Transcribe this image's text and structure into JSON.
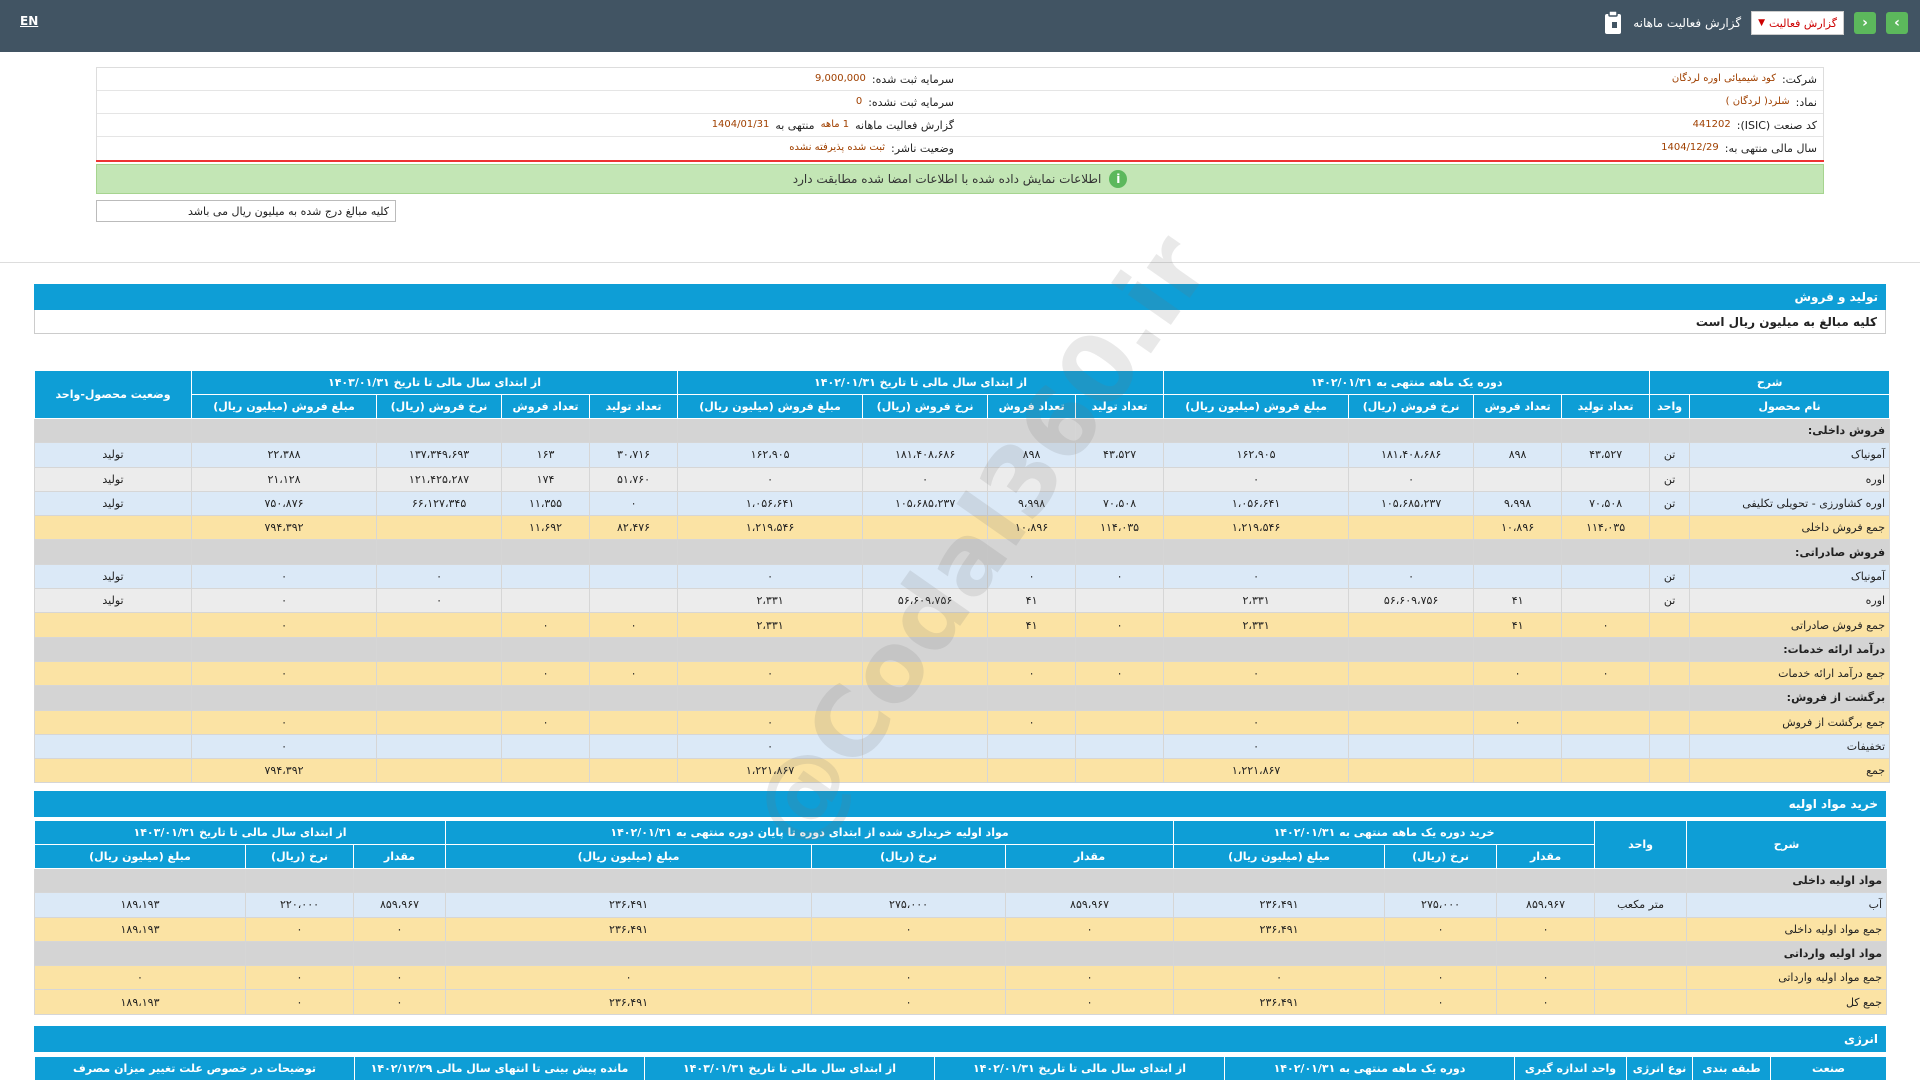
{
  "topbar": {
    "lang": "EN",
    "title": "گزارش فعالیت ماهانه",
    "select_value": "گزارش فعالیت",
    "prev_label": "›",
    "next_label": "‹"
  },
  "info": {
    "company_label": "شرکت:",
    "company_value": "کود شیمیائی اوره لردگان",
    "symbol_label": "نماد:",
    "symbol_value": "شلرد( لردگان )",
    "isic_label": "کد صنعت (ISIC):",
    "isic_value": "441202",
    "fy_label": "سال مالی منتهی به:",
    "fy_value": "1404/12/29",
    "capital_label": "سرمایه ثبت شده:",
    "capital_value": "9,000,000",
    "unreg_label": "سرمایه ثبت نشده:",
    "unreg_value": "0",
    "report_label": "گزارش فعالیت ماهانه",
    "report_value": "1 ماهه",
    "report_suffix": "منتهی به",
    "report_date": "1404/01/31",
    "status_label": "وضعیت ناشر:",
    "status_value": "ثبت شده پذیرفته نشده"
  },
  "green_message": "اطلاعات نمایش داده شده با اطلاعات امضا شده مطابقت دارد",
  "note": "کلیه مبالغ درج شده به میلیون ریال می باشد",
  "watermark": "@Codal360.ir",
  "production": {
    "title": "تولید و فروش",
    "subtitle": "کلیه مبالغ به میلیون ریال است",
    "h1": [
      "شرح",
      "دوره یک ماهه منتهی به ۱۴۰۲/۰۱/۳۱",
      "از ابتدای سال مالی تا تاریخ ۱۴۰۲/۰۱/۳۱",
      "از ابتدای سال مالی تا تاریخ ۱۴۰۳/۰۱/۳۱",
      "وضعیت محصول-واحد"
    ],
    "h2": [
      "نام محصول",
      "واحد",
      "تعداد تولید",
      "تعداد فروش",
      "نرخ فروش (ریال)",
      "مبلغ فروش (میلیون ریال)",
      "تعداد تولید",
      "تعداد فروش",
      "نرخ فروش (ریال)",
      "مبلغ فروش (میلیون ریال)",
      "تعداد تولید",
      "تعداد فروش",
      "نرخ فروش (ریال)",
      "مبلغ فروش (میلیون ریال)"
    ],
    "rows": [
      {
        "t": "grp",
        "c": [
          "فروش داخلی:",
          "",
          "",
          "",
          "",
          "",
          "",
          "",
          "",
          "",
          "",
          "",
          "",
          "",
          ""
        ]
      },
      {
        "t": "blue",
        "c": [
          "آمونیاک",
          "تن",
          "۴۳،۵۲۷",
          "۸۹۸",
          "۱۸۱،۴۰۸،۶۸۶",
          "۱۶۲،۹۰۵",
          "۴۳،۵۲۷",
          "۸۹۸",
          "۱۸۱،۴۰۸،۶۸۶",
          "۱۶۲،۹۰۵",
          "۳۰،۷۱۶",
          "۱۶۳",
          "۱۳۷،۳۴۹،۶۹۳",
          "۲۲،۳۸۸",
          "تولید"
        ]
      },
      {
        "t": "gray",
        "c": [
          "اوره",
          "تن",
          "",
          "",
          "۰",
          "۰",
          "",
          "",
          "۰",
          "۰",
          "۵۱،۷۶۰",
          "۱۷۴",
          "۱۲۱،۴۲۵،۲۸۷",
          "۲۱،۱۲۸",
          "تولید"
        ]
      },
      {
        "t": "blue",
        "c": [
          "اوره کشاورزی - تحویلی تکلیفی",
          "تن",
          "۷۰،۵۰۸",
          "۹،۹۹۸",
          "۱۰۵،۶۸۵،۲۳۷",
          "۱،۰۵۶،۶۴۱",
          "۷۰،۵۰۸",
          "۹،۹۹۸",
          "۱۰۵،۶۸۵،۲۳۷",
          "۱،۰۵۶،۶۴۱",
          "۰",
          "۱۱،۳۵۵",
          "۶۶،۱۲۷،۳۴۵",
          "۷۵۰،۸۷۶",
          "تولید"
        ]
      },
      {
        "t": "yel",
        "c": [
          "جمع فروش داخلی",
          "",
          "۱۱۴،۰۳۵",
          "۱۰،۸۹۶",
          "",
          "۱،۲۱۹،۵۴۶",
          "۱۱۴،۰۳۵",
          "۱۰،۸۹۶",
          "",
          "۱،۲۱۹،۵۴۶",
          "۸۲،۴۷۶",
          "۱۱،۶۹۲",
          "",
          "۷۹۴،۳۹۲",
          ""
        ]
      },
      {
        "t": "grp",
        "c": [
          "فروش صادراتی:",
          "",
          "",
          "",
          "",
          "",
          "",
          "",
          "",
          "",
          "",
          "",
          "",
          "",
          ""
        ]
      },
      {
        "t": "blue",
        "c": [
          "آمونیاک",
          "تن",
          "",
          "",
          "۰",
          "۰",
          "۰",
          "۰",
          "",
          "۰",
          "",
          "",
          "۰",
          "۰",
          "تولید"
        ]
      },
      {
        "t": "gray",
        "c": [
          "اوره",
          "تن",
          "",
          "۴۱",
          "۵۶،۶۰۹،۷۵۶",
          "۲،۳۳۱",
          "",
          "۴۱",
          "۵۶،۶۰۹،۷۵۶",
          "۲،۳۳۱",
          "",
          "",
          "۰",
          "۰",
          "تولید"
        ]
      },
      {
        "t": "yel",
        "c": [
          "جمع فروش صادراتی",
          "",
          "۰",
          "۴۱",
          "",
          "۲،۳۳۱",
          "۰",
          "۴۱",
          "",
          "۲،۳۳۱",
          "۰",
          "۰",
          "",
          "۰",
          ""
        ]
      },
      {
        "t": "grp",
        "c": [
          "درآمد ارائه خدمات:",
          "",
          "",
          "",
          "",
          "",
          "",
          "",
          "",
          "",
          "",
          "",
          "",
          "",
          ""
        ]
      },
      {
        "t": "yel",
        "c": [
          "جمع درآمد ارائه خدمات",
          "",
          "۰",
          "۰",
          "",
          "۰",
          "۰",
          "۰",
          "",
          "۰",
          "۰",
          "۰",
          "",
          "۰",
          ""
        ]
      },
      {
        "t": "grp",
        "c": [
          "برگشت از فروش:",
          "",
          "",
          "",
          "",
          "",
          "",
          "",
          "",
          "",
          "",
          "",
          "",
          "",
          ""
        ]
      },
      {
        "t": "yel",
        "c": [
          "جمع برگشت از فروش",
          "",
          "",
          "۰",
          "",
          "۰",
          "",
          "۰",
          "",
          "۰",
          "",
          "۰",
          "",
          "۰",
          ""
        ]
      },
      {
        "t": "blue",
        "c": [
          "تخفیفات",
          "",
          "",
          "",
          "",
          "۰",
          "",
          "",
          "",
          "۰",
          "",
          "",
          "",
          "۰",
          ""
        ]
      },
      {
        "t": "yel",
        "c": [
          "جمع",
          "",
          "",
          "",
          "",
          "۱،۲۲۱،۸۶۷",
          "",
          "",
          "",
          "۱،۲۲۱،۸۶۷",
          "",
          "",
          "",
          "۷۹۴،۳۹۲",
          ""
        ]
      }
    ]
  },
  "materials": {
    "title": "خرید مواد اولیه",
    "h1": [
      "شرح",
      "واحد",
      "خرید دوره یک ماهه منتهی به ۱۴۰۲/۰۱/۳۱",
      "مواد اولیه خریداری شده از ابتدای دوره تا پایان دوره منتهی به ۱۴۰۲/۰۱/۳۱",
      "از ابتدای سال مالی تا تاریخ ۱۴۰۳/۰۱/۳۱"
    ],
    "h2": [
      "مقدار",
      "نرخ (ریال)",
      "مبلغ (میلیون ریال)",
      "مقدار",
      "نرخ (ریال)",
      "مبلغ (میلیون ریال)",
      "مقدار",
      "نرخ (ریال)",
      "مبلغ (میلیون ریال)"
    ],
    "rows": [
      {
        "t": "grp",
        "c": [
          "مواد اولیه داخلی",
          "",
          "",
          "",
          "",
          "",
          "",
          "",
          "",
          "",
          ""
        ]
      },
      {
        "t": "blue",
        "c": [
          "آب",
          "متر مکعب",
          "۸۵۹،۹۶۷",
          "۲۷۵،۰۰۰",
          "۲۳۶،۴۹۱",
          "۸۵۹،۹۶۷",
          "۲۷۵،۰۰۰",
          "۲۳۶،۴۹۱",
          "۸۵۹،۹۶۷",
          "۲۲۰،۰۰۰",
          "۱۸۹،۱۹۳"
        ]
      },
      {
        "t": "yel",
        "c": [
          "جمع مواد اولیه داخلی",
          "",
          "۰",
          "۰",
          "۲۳۶،۴۹۱",
          "۰",
          "۰",
          "۲۳۶،۴۹۱",
          "۰",
          "۰",
          "۱۸۹،۱۹۳"
        ]
      },
      {
        "t": "grp",
        "c": [
          "مواد اولیه وارداتی",
          "",
          "",
          "",
          "",
          "",
          "",
          "",
          "",
          "",
          ""
        ]
      },
      {
        "t": "yel",
        "c": [
          "جمع مواد اولیه وارداتی",
          "",
          "۰",
          "۰",
          "۰",
          "۰",
          "۰",
          "۰",
          "۰",
          "۰",
          "۰"
        ]
      },
      {
        "t": "yel",
        "c": [
          "جمع کل",
          "",
          "۰",
          "۰",
          "۲۳۶،۴۹۱",
          "۰",
          "۰",
          "۲۳۶،۴۹۱",
          "۰",
          "۰",
          "۱۸۹،۱۹۳"
        ]
      }
    ]
  },
  "energy": {
    "title": "انرژی",
    "h1": [
      "صنعت",
      "طبقه بندی",
      "نوع انرژی",
      "واحد اندازه گیری",
      "دوره یک ماهه منتهی به ۱۴۰۲/۰۱/۳۱",
      "از ابتدای سال مالی تا تاریخ ۱۴۰۲/۰۱/۳۱",
      "از ابتدای سال مالی تا تاریخ ۱۴۰۳/۰۱/۳۱",
      "مانده پیش بینی تا انتهای سال مالی ۱۴۰۲/۱۲/۲۹",
      "توضیحات در خصوص علت تغییر میزان مصرف"
    ]
  }
}
